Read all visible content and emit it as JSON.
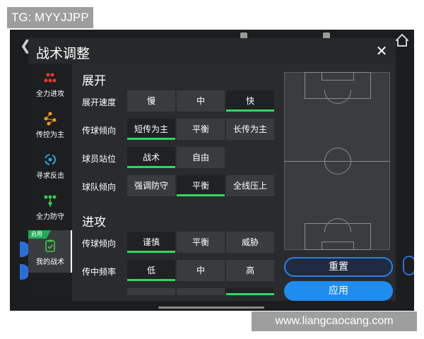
{
  "watermark_top": "TG: MYYJJPP",
  "watermark_bottom": "www.liangcaocang.com",
  "dialog": {
    "title": "战术调整",
    "close_icon": "close-icon"
  },
  "sidebar": {
    "items": [
      {
        "label": "全力进攻",
        "icon": "all-out-attack-icon"
      },
      {
        "label": "传控为主",
        "icon": "possession-icon"
      },
      {
        "label": "寻求反击",
        "icon": "counter-attack-icon"
      },
      {
        "label": "全力防守",
        "icon": "all-out-defense-icon"
      },
      {
        "label": "我的战术",
        "icon": "my-tactics-icon",
        "badge": "启用"
      }
    ],
    "active_index": 4
  },
  "sections": {
    "expand": {
      "title": "展开",
      "rows": [
        {
          "label": "展开速度",
          "options": [
            "慢",
            "中",
            "快"
          ],
          "selected": 2
        },
        {
          "label": "传球倾向",
          "options": [
            "短传为主",
            "平衡",
            "长传为主"
          ],
          "selected": 0
        },
        {
          "label": "球员站位",
          "options": [
            "战术",
            "自由"
          ],
          "selected": 0
        },
        {
          "label": "球队倾向",
          "options": [
            "强调防守",
            "平衡",
            "全线压上"
          ],
          "selected": 1
        }
      ]
    },
    "attack": {
      "title": "进攻",
      "rows": [
        {
          "label": "传球倾向",
          "options": [
            "谨慎",
            "平衡",
            "威胁"
          ],
          "selected": 0
        },
        {
          "label": "传中频率",
          "options": [
            "低",
            "中",
            "高"
          ],
          "selected": 0
        }
      ]
    }
  },
  "buttons": {
    "reset": "重置",
    "apply": "应用"
  },
  "colors": {
    "selected_underline": "#2fd85f",
    "apply_button": "#1f8cf0",
    "reset_border": "#2a7ff0",
    "badge": "#1faa59"
  }
}
